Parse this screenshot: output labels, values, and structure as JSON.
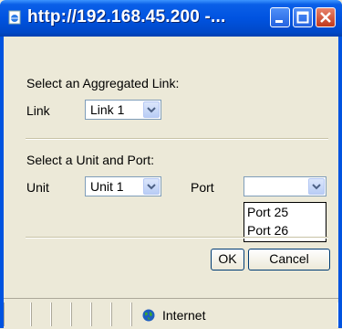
{
  "window": {
    "title": "http://192.168.45.200 -..."
  },
  "section1": {
    "heading": "Select an Aggregated Link:",
    "link_label": "Link",
    "link_value": "Link 1"
  },
  "section2": {
    "heading": "Select a Unit and Port:",
    "unit_label": "Unit",
    "unit_value": "Unit 1",
    "port_label": "Port",
    "port_value": "",
    "port_options": [
      "Port 25",
      "Port 26"
    ]
  },
  "buttons": {
    "ok": "OK",
    "cancel": "Cancel"
  },
  "status": {
    "zone": "Internet"
  },
  "colors": {
    "titlebar": "#0053e0",
    "face": "#ece9d8",
    "close": "#c1391c"
  },
  "icons": [
    "ie-page-icon",
    "minimize-icon",
    "maximize-icon",
    "close-icon",
    "chevron-down-icon",
    "globe-icon"
  ]
}
